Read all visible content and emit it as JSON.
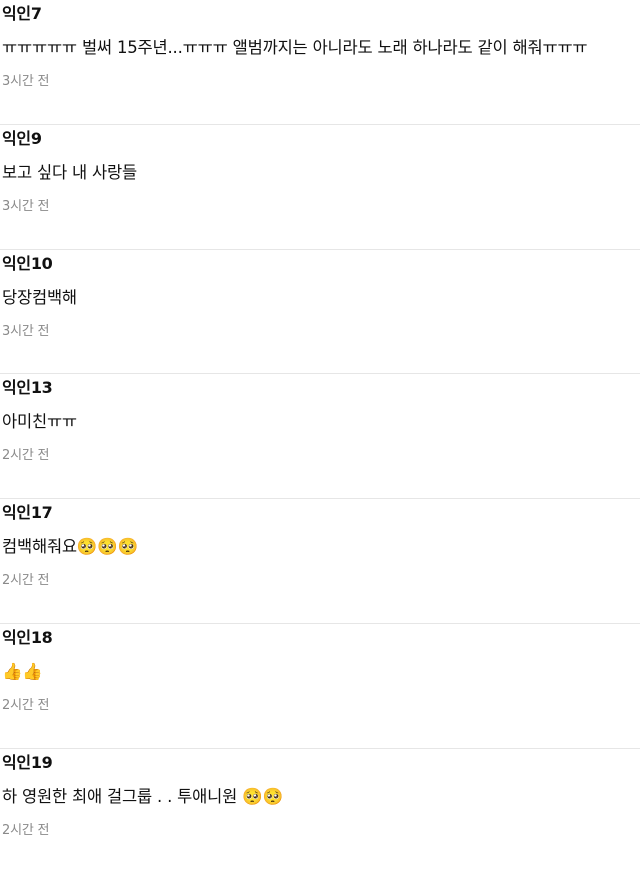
{
  "comments": [
    {
      "author": "익인7",
      "text": "ㅠㅠㅠㅠㅠ 벌써 15주년...ㅠㅠㅠ 앨범까지는 아니라도 노래 하나라도 같이 해줘ㅠㅠㅠ",
      "time": "3시간 전"
    },
    {
      "author": "익인9",
      "text": "보고 싶다 내 사랑들",
      "time": "3시간 전"
    },
    {
      "author": "익인10",
      "text": "당장컴백해",
      "time": "3시간 전"
    },
    {
      "author": "익인13",
      "text": "아미친ㅠㅠ",
      "time": "2시간 전"
    },
    {
      "author": "익인17",
      "text": "컴백해줘요🥺🥺🥺",
      "time": "2시간 전"
    },
    {
      "author": "익인18",
      "text": "👍👍",
      "time": "2시간 전"
    },
    {
      "author": "익인19",
      "text": "하 영원한 최애 걸그룹 . . 투애니원 🥺🥺",
      "time": "2시간 전"
    }
  ]
}
